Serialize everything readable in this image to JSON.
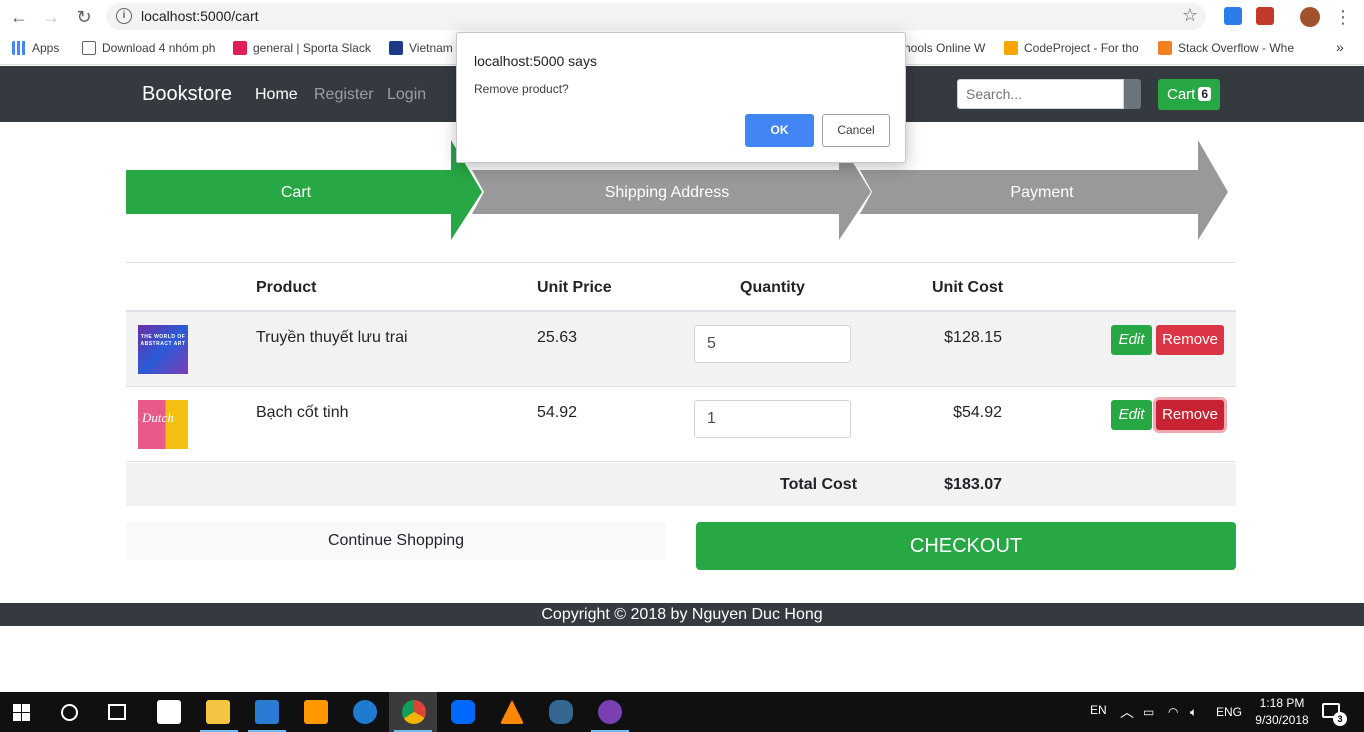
{
  "browser": {
    "url": "localhost:5000/cart",
    "bookmarks": [
      {
        "label": "Apps"
      },
      {
        "label": "Download 4 nhóm ph"
      },
      {
        "label": "general | Sporta Slack"
      },
      {
        "label": "Vietnam"
      },
      {
        "label": "hools Online W"
      },
      {
        "label": "CodeProject - For tho"
      },
      {
        "label": "Stack Overflow - Whe"
      }
    ],
    "more": "»"
  },
  "site": {
    "brand": "Bookstore",
    "nav": [
      {
        "label": "Home"
      },
      {
        "label": "Register"
      },
      {
        "label": "Login"
      }
    ],
    "search_placeholder": "Search...",
    "cart_label": "Cart",
    "cart_count": "6"
  },
  "steps": [
    {
      "label": "Cart",
      "color": "#28a745"
    },
    {
      "label": "Shipping Address",
      "color": "#999999"
    },
    {
      "label": "Payment",
      "color": "#999999"
    }
  ],
  "table": {
    "headers": {
      "product": "Product",
      "unit_price": "Unit Price",
      "quantity": "Quantity",
      "unit_cost": "Unit Cost"
    },
    "rows": [
      {
        "name": "Truyền thuyết lưu trai",
        "unit_price": "25.63",
        "quantity": "5",
        "unit_cost": "$128.15",
        "edit": "Edit",
        "remove": "Remove",
        "thumb_text": "THE WORLD OF ABSTRACT ART"
      },
      {
        "name": "Bạch cốt tinh",
        "unit_price": "54.92",
        "quantity": "1",
        "unit_cost": "$54.92",
        "edit": "Edit",
        "remove": "Remove",
        "thumb_text": "Dutch"
      }
    ],
    "total_label": "Total Cost",
    "total_value": "$183.07"
  },
  "actions": {
    "continue": "Continue Shopping",
    "checkout": "CHECKOUT"
  },
  "footer": "Copyright © 2018 by Nguyen Duc Hong",
  "dialog": {
    "title": "localhost:5000 says",
    "message": "Remove product?",
    "ok": "OK",
    "cancel": "Cancel"
  },
  "taskbar": {
    "lang1": "EN",
    "lang2": "ENG",
    "time": "1:18 PM",
    "date": "9/30/2018",
    "notifications": "3"
  }
}
